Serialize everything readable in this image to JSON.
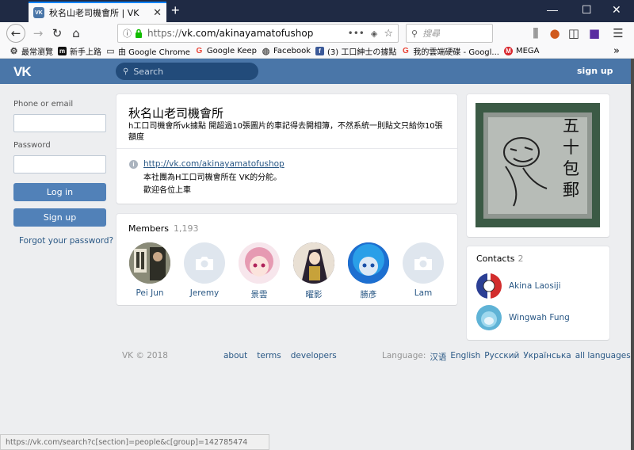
{
  "browser": {
    "tab_title": "秋名山老司機會所 | VK",
    "tab_favicon": "VK",
    "url_prefix": "https://",
    "url_main": "vk.com/akinayamatofushop",
    "search_placeholder": "搜尋",
    "bookmarks": [
      {
        "label": "最常瀏覽",
        "icon": "gear-icon",
        "color": "#444444"
      },
      {
        "label": "新手上路",
        "icon": "m-icon",
        "color": "#111111"
      },
      {
        "label": "由 Google Chrome",
        "icon": "folder-icon",
        "color": "#8a8a8a"
      },
      {
        "label": "Google Keep",
        "icon": "google-icon",
        "color": "#ea4335"
      },
      {
        "label": "Facebook",
        "icon": "globe-icon",
        "color": "#555555"
      },
      {
        "label": "(3) 工口紳士の據點",
        "icon": "facebook-icon",
        "color": "#3b5998"
      },
      {
        "label": "我的雲端硬碟 - Googl...",
        "icon": "google-icon",
        "color": "#ea4335"
      },
      {
        "label": "MEGA",
        "icon": "mega-icon",
        "color": "#d9272e"
      }
    ],
    "status_url": "https://vk.com/search?c[section]=people&c[group]=142785474"
  },
  "vk": {
    "logo": "VK",
    "search_placeholder": "Search",
    "signup_top": "sign up",
    "brand_color": "#4a76a8"
  },
  "login": {
    "phone_label": "Phone or email",
    "password_label": "Password",
    "login_button": "Log in",
    "signup_button": "Sign up",
    "forgot": "Forgot your password?"
  },
  "group": {
    "name": "秋名山老司機會所",
    "status": "h工口司機會所vk據點 開超過10張圖片的車記得去開相簿，不然系統一則貼文只給你10張額度",
    "link": "http://vk.com/akinayamatofushop",
    "description_line1": "本社團為H工口司機會所在 VK的分舵。",
    "description_line2": "歡迎各位上車"
  },
  "members": {
    "title": "Members",
    "count": "1,193",
    "list": [
      {
        "name": "Pei Jun",
        "avatar": "photo"
      },
      {
        "name": "Jeremy",
        "avatar": "empty"
      },
      {
        "name": "景雲",
        "avatar": "anime-pink"
      },
      {
        "name": "曜影",
        "avatar": "anime-dark"
      },
      {
        "name": "勝彥",
        "avatar": "anime-blue"
      },
      {
        "name": "Lam",
        "avatar": "empty"
      }
    ]
  },
  "contacts": {
    "title": "Contacts",
    "count": "2",
    "list": [
      {
        "name": "Akina Laosiji"
      },
      {
        "name": "Wingwah Fung"
      }
    ]
  },
  "cover_text": "五十包郵",
  "footer": {
    "copyright": "VK © 2018",
    "links": [
      "about",
      "terms",
      "developers"
    ],
    "language_label": "Language:",
    "languages": [
      "汉语",
      "English",
      "Русский",
      "Українська",
      "all languages »"
    ]
  }
}
